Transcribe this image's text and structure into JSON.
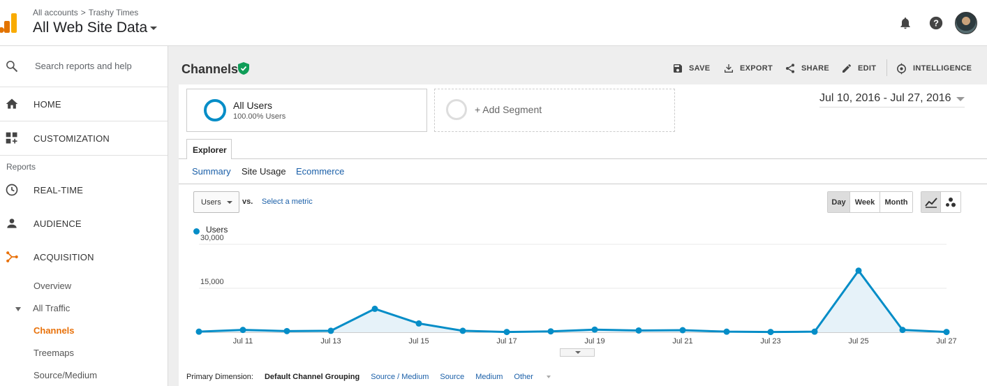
{
  "header": {
    "breadcrumb": [
      "All accounts",
      "Trashy Times"
    ],
    "breadcrumb_sep": ">",
    "view_title": "All Web Site Data",
    "icons": [
      "bell-icon",
      "help-icon",
      "avatar"
    ]
  },
  "sidebar": {
    "search_placeholder": "Search reports and help",
    "home": "HOME",
    "customization": "CUSTOMIZATION",
    "reports_label": "Reports",
    "realtime": "REAL-TIME",
    "audience": "AUDIENCE",
    "acquisition": "ACQUISITION",
    "overview": "Overview",
    "all_traffic": "All Traffic",
    "channels": "Channels",
    "treemaps": "Treemaps",
    "source_medium": "Source/Medium",
    "accent_color": "#e8710a"
  },
  "page": {
    "title": "Channels",
    "actions": {
      "save": "SAVE",
      "export": "EXPORT",
      "share": "SHARE",
      "edit": "EDIT",
      "intelligence": "INTELLIGENCE"
    }
  },
  "segments": {
    "segment_name": "All Users",
    "segment_sub": "100.00% Users",
    "add_segment": "+ Add Segment"
  },
  "date_range": "Jul 10, 2016 - Jul 27, 2016",
  "explorer": {
    "tab": "Explorer",
    "subtabs": [
      "Summary",
      "Site Usage",
      "Ecommerce"
    ],
    "metric": "Users",
    "vs": "vs.",
    "select_metric": "Select a metric",
    "granularity": [
      "Day",
      "Week",
      "Month"
    ],
    "granularity_selected": "Day",
    "legend": "Users"
  },
  "chart_data": {
    "type": "area",
    "x": [
      "Jul 10",
      "Jul 11",
      "Jul 12",
      "Jul 13",
      "Jul 14",
      "Jul 15",
      "Jul 16",
      "Jul 17",
      "Jul 18",
      "Jul 19",
      "Jul 20",
      "Jul 21",
      "Jul 22",
      "Jul 23",
      "Jul 24",
      "Jul 25",
      "Jul 26",
      "Jul 27"
    ],
    "tick_labels": [
      "Jul 11",
      "Jul 13",
      "Jul 15",
      "Jul 17",
      "Jul 19",
      "Jul 21",
      "Jul 23",
      "Jul 25",
      "Jul 27"
    ],
    "series": [
      {
        "name": "Users",
        "values": [
          200,
          800,
          400,
          500,
          8000,
          3000,
          500,
          100,
          300,
          900,
          600,
          700,
          200,
          100,
          200,
          21000,
          800,
          100
        ]
      }
    ],
    "y_ticks": [
      "30,000",
      "15,000"
    ],
    "ylim": [
      0,
      30000
    ],
    "grid": true,
    "line_color": "#058dc7",
    "fill_color": "#e6f2f9"
  },
  "dimension": {
    "label": "Primary Dimension:",
    "current": "Default Channel Grouping",
    "options": [
      "Source / Medium",
      "Source",
      "Medium",
      "Other"
    ]
  }
}
